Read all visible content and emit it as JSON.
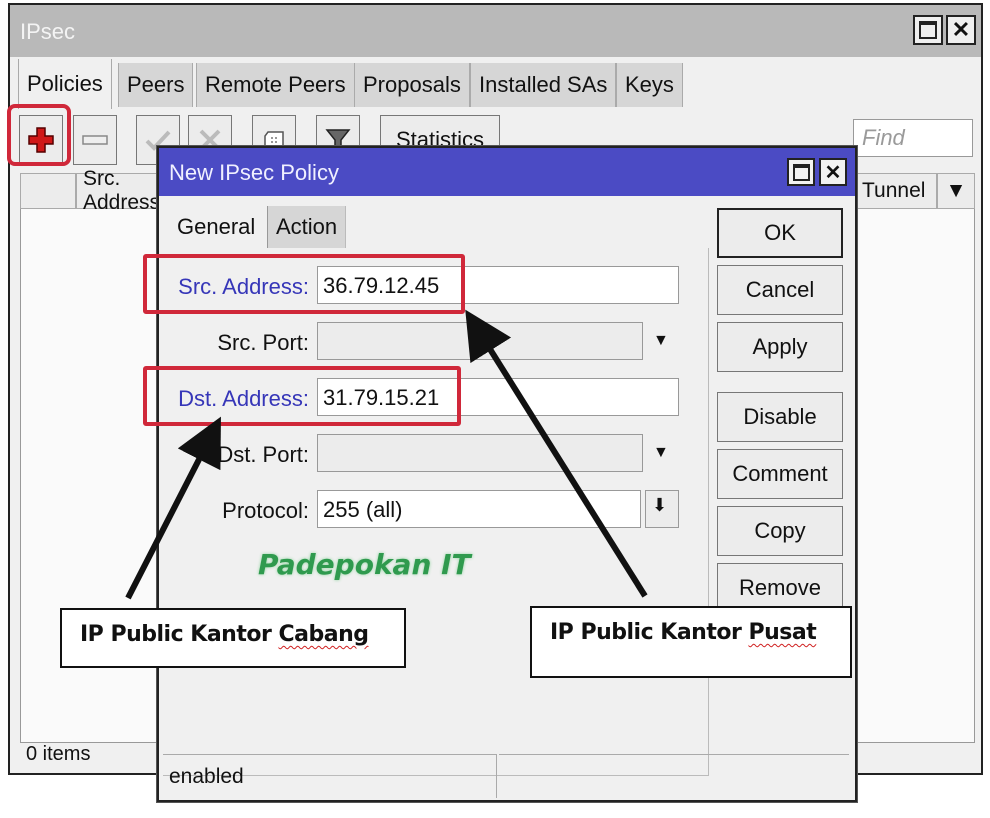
{
  "window": {
    "title": "IPsec",
    "maximize_icon": "maximize-icon",
    "close_icon": "close-icon",
    "tabs": [
      {
        "label": "Policies",
        "active": true
      },
      {
        "label": "Peers",
        "active": false
      },
      {
        "label": "Remote Peers",
        "active": false
      },
      {
        "label": "Proposals",
        "active": false
      },
      {
        "label": "Installed SAs",
        "active": false
      },
      {
        "label": "Keys",
        "active": false
      }
    ],
    "toolbar": {
      "add_icon": "plus-icon",
      "remove_icon": "minus-icon",
      "enable_icon": "check-icon",
      "disable_icon": "x-icon",
      "comment_icon": "comment-icon",
      "filter_icon": "filter-icon",
      "statistics_label": "Statistics",
      "find_placeholder": "Find"
    },
    "columns": [
      "Src. Address",
      "Tunnel"
    ],
    "status": "0 items"
  },
  "dialog": {
    "title": "New IPsec Policy",
    "tabs": [
      {
        "label": "General",
        "active": true
      },
      {
        "label": "Action",
        "active": false
      }
    ],
    "fields": {
      "src_address": {
        "label": "Src. Address:",
        "value": "36.79.12.45"
      },
      "src_port": {
        "label": "Src. Port:",
        "value": ""
      },
      "dst_address": {
        "label": "Dst. Address:",
        "value": "31.79.15.21"
      },
      "dst_port": {
        "label": "Dst. Port:",
        "value": ""
      },
      "protocol": {
        "label": "Protocol:",
        "value": "255 (all)"
      }
    },
    "buttons": [
      "OK",
      "Cancel",
      "Apply",
      "Disable",
      "Comment",
      "Copy",
      "Remove"
    ],
    "status": "enabled"
  },
  "annotations": {
    "brand": "Padepokan IT",
    "callout_left": {
      "prefix": "IP Public Kantor ",
      "underlined": "Cabang"
    },
    "callout_right": {
      "prefix": "IP Public Kantor ",
      "underlined": "Pusat"
    },
    "highlight_color": "#d0283a"
  }
}
